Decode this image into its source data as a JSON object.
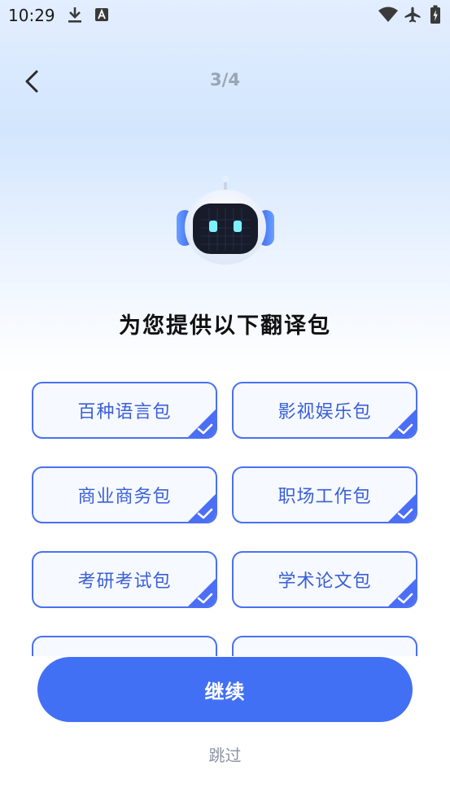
{
  "status_bar": {
    "time": "10:29",
    "icons": [
      "download-icon",
      "keyboard-a-icon",
      "wifi-icon",
      "airplane-icon",
      "battery-charging-icon"
    ]
  },
  "header": {
    "back_icon": "chevron-left-icon",
    "step": "3/4"
  },
  "mascot": {
    "icon": "robot-mascot-icon"
  },
  "title": "为您提供以下翻译包",
  "packages": [
    {
      "label": "百种语言包",
      "selected": true
    },
    {
      "label": "影视娱乐包",
      "selected": true
    },
    {
      "label": "商业商务包",
      "selected": true
    },
    {
      "label": "职场工作包",
      "selected": true
    },
    {
      "label": "考研考试包",
      "selected": true
    },
    {
      "label": "学术论文包",
      "selected": true
    },
    {
      "label": "",
      "selected": true
    },
    {
      "label": "",
      "selected": true
    }
  ],
  "continue_label": "继续",
  "skip_label": "跳过",
  "colors": {
    "accent": "#4270f5",
    "card_border": "#4a70f5",
    "card_text": "#3a60d8",
    "step_text": "#9aa4b4",
    "skip_text": "#8c94a3"
  }
}
